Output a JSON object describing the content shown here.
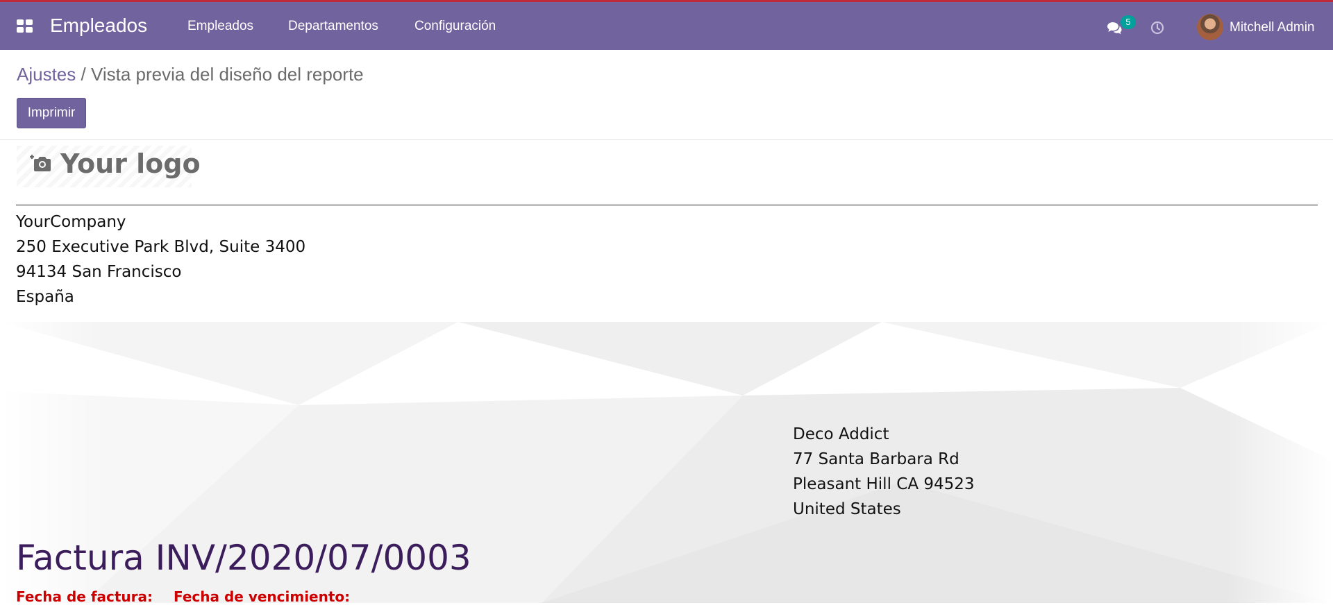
{
  "topbar": {
    "app_title": "Empleados",
    "menu": [
      "Empleados",
      "Departamentos",
      "Configuración"
    ],
    "messages_count": "5",
    "user_name": "Mitchell Admin",
    "colors": {
      "bar": "#71639e",
      "accent_line": "#c0293b",
      "badge": "#00a09d"
    }
  },
  "breadcrumb": {
    "parent": "Ajustes",
    "separator": "/",
    "current": "Vista previa del diseño del reporte"
  },
  "actions": {
    "print_label": "Imprimir"
  },
  "report": {
    "logo_text": "Your logo",
    "company": [
      "YourCompany",
      "250 Executive Park Blvd, Suite 3400",
      "94134 San Francisco",
      "España"
    ],
    "partner": [
      "Deco Addict",
      "77 Santa Barbara Rd",
      "Pleasant Hill CA 94523",
      "United States"
    ],
    "invoice_title": "Factura INV/2020/07/0003",
    "labels": {
      "invoice_date": "Fecha de factura:",
      "due_date": "Fecha de vencimiento:"
    },
    "colors": {
      "title": "#3c1d5c",
      "labels": "#cc0000"
    }
  }
}
